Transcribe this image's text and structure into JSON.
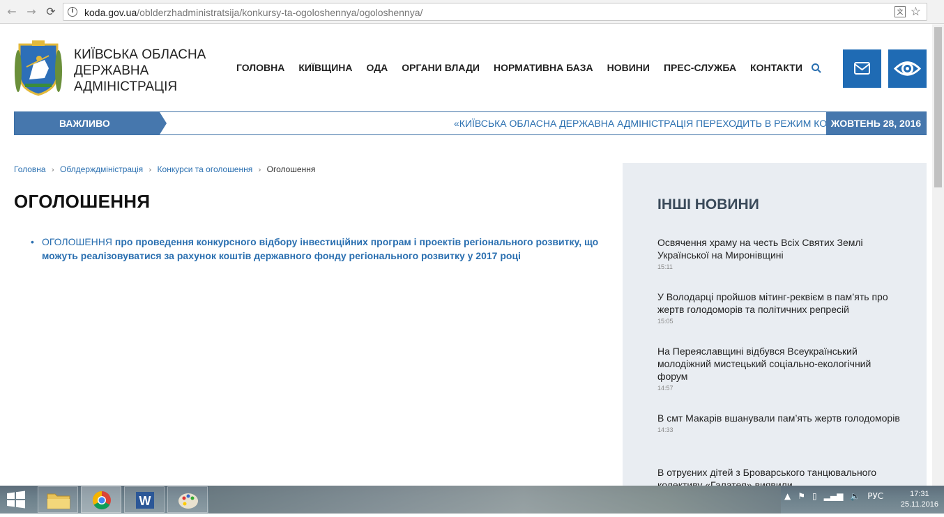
{
  "browser": {
    "url_host": "koda.gov.ua",
    "url_path": "/oblderzhadministratsija/konkursy-ta-ogoloshennya/ogoloshennya/",
    "back_glyph": "←",
    "forward_glyph": "→",
    "reload_glyph": "⟳",
    "star_glyph": "☆"
  },
  "header": {
    "org_name_line1": "КИЇВСЬКА ОБЛАСНА",
    "org_name_line2": "ДЕРЖАВНА",
    "org_name_line3": "АДМІНІСТРАЦІЯ",
    "nav": [
      "ГОЛОВНА",
      "КИЇВЩИНА",
      "ОДА",
      "ОРГАНИ ВЛАДИ",
      "НОРМАТИВНА БАЗА",
      "НОВИНИ",
      "ПРЕС-СЛУЖБА",
      "КОНТАКТИ"
    ],
    "accent_color": "#1f6bb4"
  },
  "ticker": {
    "label": "ВАЖЛИВО",
    "text": "«КИЇВСЬКА ОБЛАСНА ДЕРЖАВНА АДМІНІСТРАЦІЯ ПЕРЕХОДИТЬ В РЕЖИМ КОМПАКТНОЇ",
    "date": "ЖОВТЕНЬ 28, 2016"
  },
  "breadcrumb": {
    "items": [
      "Головна",
      "Облдерждміністрація",
      "Конкурси та оголошення"
    ],
    "current": "Оголошення",
    "separator": "›"
  },
  "page": {
    "title": "ОГОЛОШЕННЯ",
    "item_lead": "ОГОЛОШЕННЯ",
    "item_rest": " про проведення конкурсного відбору інвестиційних програм і проектів регіонального розвитку, що можуть реалізовуватися за рахунок коштів державного фонду регіонального розвитку у 2017 році"
  },
  "sidebar": {
    "title": "ІНШІ НОВИНИ",
    "news": [
      {
        "title": "Освячення храму на честь Всіх Святих Землі Української на Миронівщині",
        "time": "15:11"
      },
      {
        "title": "У Володарці пройшов мітинг-реквієм в пам’ять про жертв голодоморів та політичних репресій",
        "time": "15:05"
      },
      {
        "title": "На Переяславщині відбувся Всеукраїнський молодіжний мистецький соціально-екологічний форум",
        "time": "14:57"
      },
      {
        "title": "В смт Макарів вшанували пам’ять жертв голодоморів",
        "time": "14:33"
      },
      {
        "title": "В отруєних дітей з Броварського танцювального колективу «Галатея» виявили",
        "time": ""
      }
    ]
  },
  "taskbar": {
    "language": "РУС",
    "time": "17:31",
    "date": "25.11.2016"
  }
}
